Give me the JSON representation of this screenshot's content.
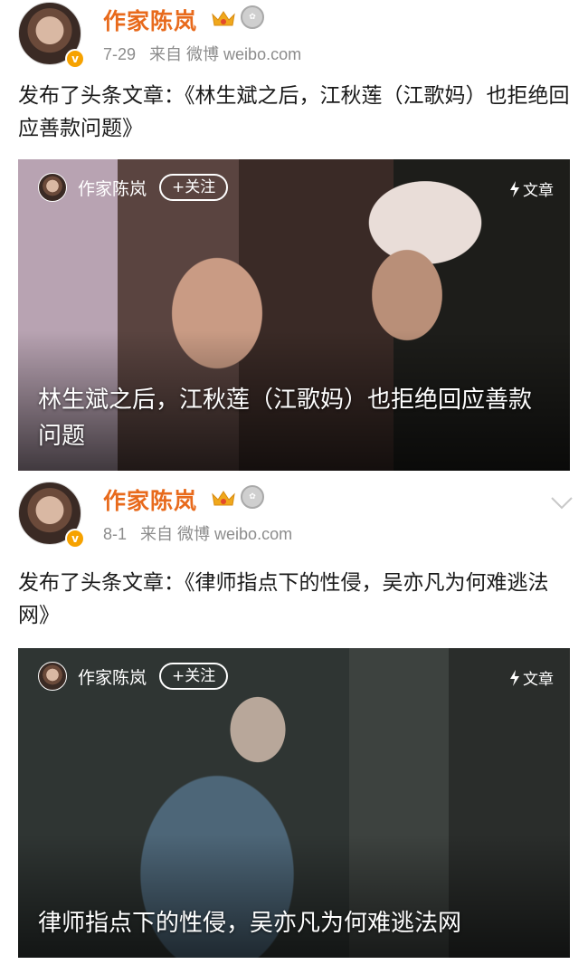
{
  "posts": [
    {
      "author": "作家陈岚",
      "date": "7-29",
      "source": "来自 微博 weibo.com",
      "text": "发布了头条文章：《林生斌之后，江秋莲（江歌妈）也拒绝回应善款问题》",
      "card": {
        "author": "作家陈岚",
        "follow_label": "+关注",
        "type_label": "文章",
        "title": "林生斌之后，江秋莲（江歌妈）也拒绝回应善款问题"
      }
    },
    {
      "author": "作家陈岚",
      "date": "8-1",
      "source": "来自 微博 weibo.com",
      "text": "发布了头条文章：《律师指点下的性侵，吴亦凡为何难逃法网》",
      "card": {
        "author": "作家陈岚",
        "follow_label": "+关注",
        "type_label": "文章",
        "title": "律师指点下的性侵，吴亦凡为何难逃法网"
      }
    }
  ],
  "colors": {
    "author_name": "#e86a1c",
    "verify_badge": "#f6a200",
    "meta_text": "#8c8c8c"
  },
  "icons": [
    "verified-badge-icon",
    "crown-icon",
    "level-medal-icon",
    "chevron-down-icon",
    "bolt-icon"
  ]
}
